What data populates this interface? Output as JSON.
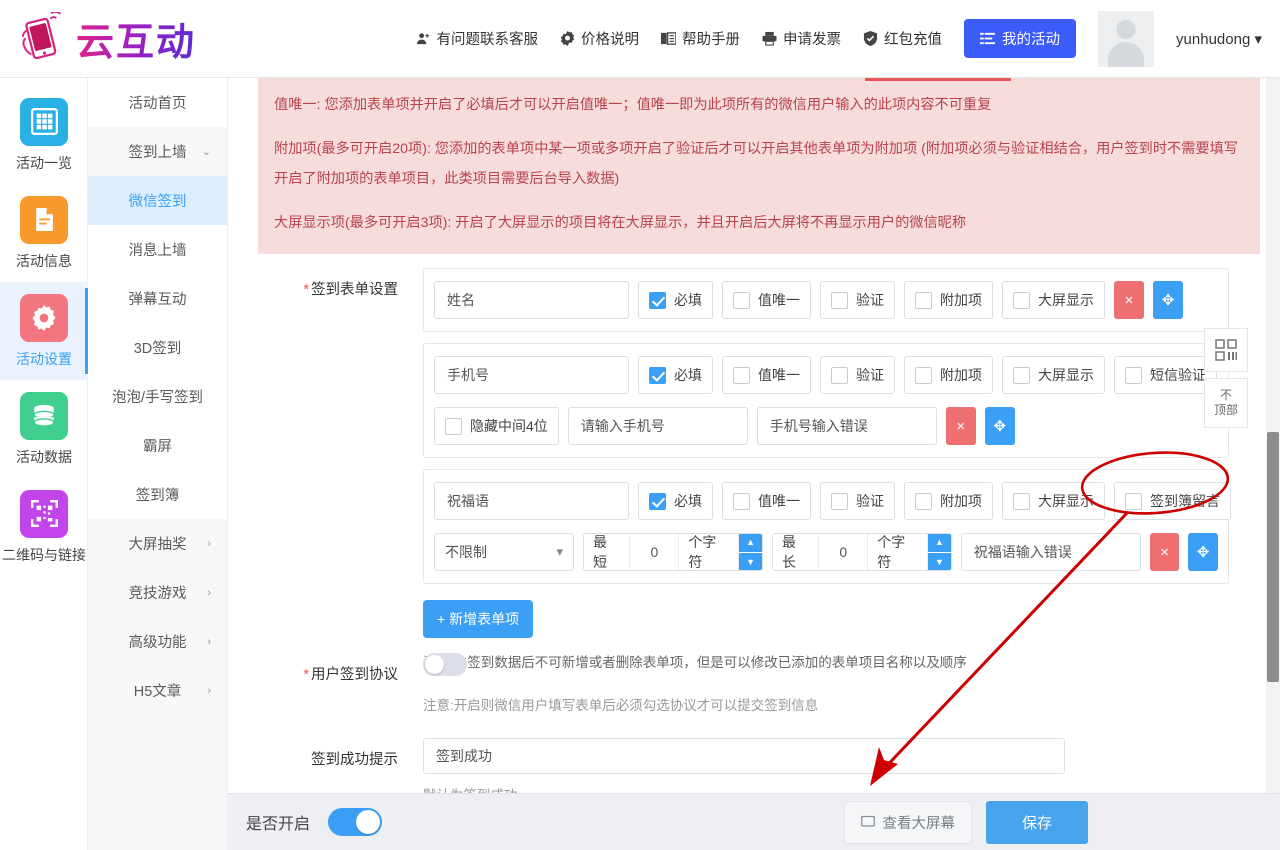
{
  "header": {
    "logo_text": "云互动",
    "nav": [
      {
        "label": "有问题联系客服",
        "icon": "customer-service-icon"
      },
      {
        "label": "价格说明",
        "icon": "price-tag-icon"
      },
      {
        "label": "帮助手册",
        "icon": "book-icon"
      },
      {
        "label": "申请发票",
        "icon": "printer-icon"
      },
      {
        "label": "红包充值",
        "icon": "shield-check-icon"
      }
    ],
    "primary_button": "我的活动",
    "username": "yunhudong"
  },
  "rail": {
    "items": [
      {
        "label": "活动一览",
        "icon": "grid-icon",
        "color": "#29b0e5",
        "active": false
      },
      {
        "label": "活动信息",
        "icon": "document-icon",
        "color": "#f79a2b",
        "active": false
      },
      {
        "label": "活动设置",
        "icon": "gear-icon",
        "color": "#f1767f",
        "active": true
      },
      {
        "label": "活动数据",
        "icon": "database-icon",
        "color": "#3fcf8e",
        "active": false
      },
      {
        "label": "二维码与链接",
        "icon": "qrcode-icon",
        "color": "#c145ea",
        "active": false
      }
    ]
  },
  "subnav": {
    "items": [
      {
        "label": "活动首页",
        "chevron": "",
        "active": false,
        "white": true
      },
      {
        "label": "签到上墙",
        "chevron": "⌄",
        "active": false,
        "white": false
      },
      {
        "label": "微信签到",
        "chevron": "",
        "active": true,
        "white": false
      },
      {
        "label": "消息上墙",
        "chevron": "",
        "active": false,
        "white": true
      },
      {
        "label": "弹幕互动",
        "chevron": "",
        "active": false,
        "white": true
      },
      {
        "label": "3D签到",
        "chevron": "",
        "active": false,
        "white": true
      },
      {
        "label": "泡泡/手写签到",
        "chevron": "",
        "active": false,
        "white": true
      },
      {
        "label": "霸屏",
        "chevron": "",
        "active": false,
        "white": true
      },
      {
        "label": "签到簿",
        "chevron": "",
        "active": false,
        "white": true
      },
      {
        "label": "大屏抽奖",
        "chevron": "›",
        "active": false,
        "white": false
      },
      {
        "label": "竞技游戏",
        "chevron": "›",
        "active": false,
        "white": false
      },
      {
        "label": "高级功能",
        "chevron": "›",
        "active": false,
        "white": false
      },
      {
        "label": "H5文章",
        "chevron": "›",
        "active": false,
        "white": false
      }
    ]
  },
  "alert": {
    "line1": "值唯一: 您添加表单项并开启了必填后才可以开启值唯一；值唯一即为此项所有的微信用户输入的此项内容不可重复",
    "line2": "附加项(最多可开启20项): 您添加的表单项中某一项或多项开启了验证后才可以开启其他表单项为附加项 (附加项必须与验证相结合，用户签到时不需要填写开启了附加项的表单项目，此类项目需要后台导入数据)",
    "line3": "大屏显示项(最多可开启3项): 开启了大屏显示的项目将在大屏显示，并且开启后大屏将不再显示用户的微信昵称"
  },
  "form": {
    "form_settings_label": "签到表单设置",
    "form_settings_required": "*",
    "rows": [
      {
        "name_value": "姓名",
        "checkboxes": [
          {
            "label": "必填",
            "checked": true
          },
          {
            "label": "值唯一",
            "checked": false
          },
          {
            "label": "验证",
            "checked": false
          },
          {
            "label": "附加项",
            "checked": false
          },
          {
            "label": "大屏显示",
            "checked": false
          }
        ],
        "delete_label": "×",
        "move_label": "✥"
      },
      {
        "name_value": "手机号",
        "checkboxes": [
          {
            "label": "必填",
            "checked": true
          },
          {
            "label": "值唯一",
            "checked": false
          },
          {
            "label": "验证",
            "checked": false
          },
          {
            "label": "附加项",
            "checked": false
          },
          {
            "label": "大屏显示",
            "checked": false
          },
          {
            "label": "短信验证",
            "checked": false
          }
        ],
        "second_line": {
          "hide_mid_label": "隐藏中间4位",
          "hide_mid_checked": false,
          "placeholder_value": "请输入手机号",
          "error_value": "手机号输入错误"
        },
        "delete_label": "×",
        "move_label": "✥"
      },
      {
        "name_value": "祝福语",
        "checkboxes": [
          {
            "label": "必填",
            "checked": true
          },
          {
            "label": "值唯一",
            "checked": false
          },
          {
            "label": "验证",
            "checked": false
          },
          {
            "label": "附加项",
            "checked": false
          },
          {
            "label": "大屏显示",
            "checked": false
          },
          {
            "label": "签到簿留言",
            "checked": false,
            "highlighted": true
          }
        ],
        "second_line": {
          "select_value": "不限制",
          "min_label": "最短",
          "min_value": "0",
          "min_unit": "个字符",
          "max_label": "最长",
          "max_value": "0",
          "max_unit": "个字符",
          "error_value": "祝福语输入错误"
        },
        "delete_label": "×",
        "move_label": "✥"
      }
    ],
    "add_button": "+ 新增表单项",
    "add_note": "注:产生签到数据后不可新增或者删除表单项，但是可以修改已添加的表单项目名称以及顺序",
    "agreement_label": "用户签到协议",
    "agreement_required": "*",
    "agreement_on": false,
    "agreement_note": "注意:开启则微信用户填写表单后必须勾选协议才可以提交签到信息",
    "success_label": "签到成功提示",
    "success_value": "签到成功",
    "success_note": "默认为签到成功"
  },
  "float_buttons": [
    {
      "label": "",
      "icon": "qr-grid-icon"
    },
    {
      "label_top": "不",
      "label": "顶部",
      "icon": "arrow-up-icon"
    }
  ],
  "bottombar": {
    "toggle_label": "是否开启",
    "toggle_on": true,
    "view_screen_button": "查看大屏幕",
    "view_screen_icon": "monitor-icon",
    "save_button": "保存"
  },
  "colors": {
    "accent_blue": "#3ba0f5",
    "primary_blue": "#3b5bfa",
    "danger_red": "#ef7070",
    "annotation_red": "#cc0000",
    "alert_bg": "#f7dcdc",
    "alert_text": "#b8444c"
  }
}
